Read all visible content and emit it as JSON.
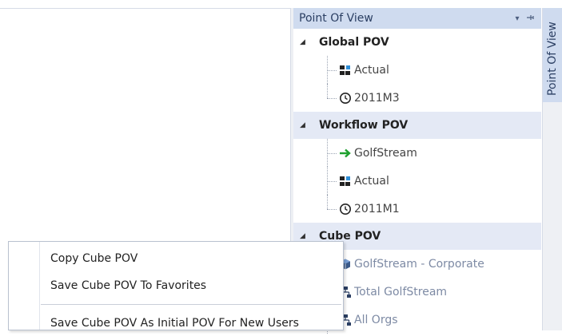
{
  "pov_panel": {
    "title": "Point Of View",
    "dropdown_glyph": "▾",
    "pin_glyph": "ᚹ",
    "groups": [
      {
        "label": "Global POV",
        "items": [
          {
            "label": "Actual",
            "icon": "scenario-icon"
          },
          {
            "label": "2011M3",
            "icon": "clock-icon"
          }
        ]
      },
      {
        "label": "Workflow POV",
        "items": [
          {
            "label": "GolfStream",
            "icon": "green-arrow-icon"
          },
          {
            "label": "Actual",
            "icon": "scenario-icon"
          },
          {
            "label": "2011M1",
            "icon": "clock-icon"
          }
        ]
      },
      {
        "label": "Cube POV",
        "items": [
          {
            "label": "GolfStream - Corporate",
            "icon": "cube-icon"
          },
          {
            "label": "Total GolfStream",
            "icon": "hierarchy-icon"
          },
          {
            "label": "All Orgs",
            "icon": "hierarchy-icon"
          }
        ]
      }
    ]
  },
  "side_tab": {
    "label": "Point Of View"
  },
  "context_menu": {
    "items": [
      {
        "label": "Copy Cube POV"
      },
      {
        "label": "Save Cube POV To Favorites"
      },
      {
        "label": "Save Cube POV As Initial POV For New Users"
      }
    ]
  },
  "colors": {
    "header_bg": "#cfdbef",
    "selected_row_bg": "#e4e9f5",
    "accent_green": "#1fa12f",
    "scenario_blue": "#2f8fd8"
  }
}
